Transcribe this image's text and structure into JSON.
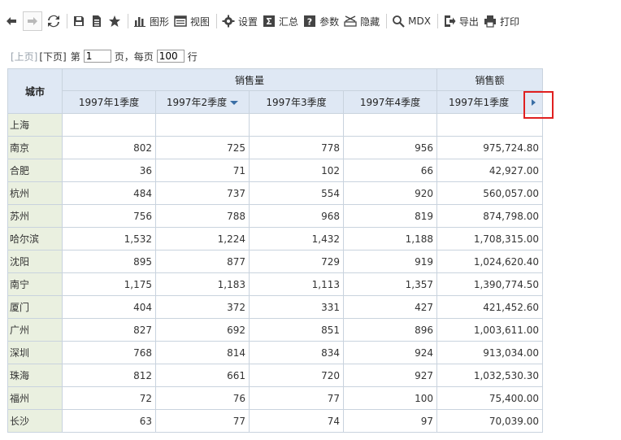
{
  "toolbar": {
    "chart_label": "图形",
    "view_label": "视图",
    "settings_label": "设置",
    "summary_label": "汇总",
    "params_label": "参数",
    "hide_label": "隐藏",
    "mdx_label": "MDX",
    "export_label": "导出",
    "print_label": "打印"
  },
  "pager": {
    "prev": "[上页]",
    "next": "[下页]",
    "page_prefix": "第",
    "page_value": "1",
    "page_suffix": "页，每页",
    "rows_value": "100",
    "rows_suffix": "行"
  },
  "table": {
    "city_header": "城市",
    "group_sales_qty": "销售量",
    "group_sales_amt": "销售额",
    "col1": "1997年1季度",
    "col2": "1997年2季度",
    "col3": "1997年3季度",
    "col4": "1997年4季度",
    "col5": "1997年1季度",
    "rows": [
      {
        "city": "上海",
        "q1": "",
        "q2": "",
        "q3": "",
        "q4": "",
        "amt": ""
      },
      {
        "city": "南京",
        "q1": "802",
        "q2": "725",
        "q3": "778",
        "q4": "956",
        "amt": "975,724.80"
      },
      {
        "city": "合肥",
        "q1": "36",
        "q2": "71",
        "q3": "102",
        "q4": "66",
        "amt": "42,927.00"
      },
      {
        "city": "杭州",
        "q1": "484",
        "q2": "737",
        "q3": "554",
        "q4": "920",
        "amt": "560,057.00"
      },
      {
        "city": "苏州",
        "q1": "756",
        "q2": "788",
        "q3": "968",
        "q4": "819",
        "amt": "874,798.00"
      },
      {
        "city": "哈尔滨",
        "q1": "1,532",
        "q2": "1,224",
        "q3": "1,432",
        "q4": "1,188",
        "amt": "1,708,315.00"
      },
      {
        "city": "沈阳",
        "q1": "895",
        "q2": "877",
        "q3": "729",
        "q4": "919",
        "amt": "1,024,620.40"
      },
      {
        "city": "南宁",
        "q1": "1,175",
        "q2": "1,183",
        "q3": "1,113",
        "q4": "1,357",
        "amt": "1,390,774.50"
      },
      {
        "city": "厦门",
        "q1": "404",
        "q2": "372",
        "q3": "331",
        "q4": "427",
        "amt": "421,452.60"
      },
      {
        "city": "广州",
        "q1": "827",
        "q2": "692",
        "q3": "851",
        "q4": "896",
        "amt": "1,003,611.00"
      },
      {
        "city": "深圳",
        "q1": "768",
        "q2": "814",
        "q3": "834",
        "q4": "924",
        "amt": "913,034.00"
      },
      {
        "city": "珠海",
        "q1": "812",
        "q2": "661",
        "q3": "720",
        "q4": "927",
        "amt": "1,032,530.30"
      },
      {
        "city": "福州",
        "q1": "72",
        "q2": "76",
        "q3": "77",
        "q4": "100",
        "amt": "75,400.00"
      },
      {
        "city": "长沙",
        "q1": "63",
        "q2": "77",
        "q3": "74",
        "q4": "97",
        "amt": "70,039.00"
      }
    ]
  },
  "colors": {
    "header_bg": "#dfe8f4",
    "city_bg": "#eaf0e0",
    "highlight": "#e02020",
    "accent": "#3a6ea5"
  }
}
